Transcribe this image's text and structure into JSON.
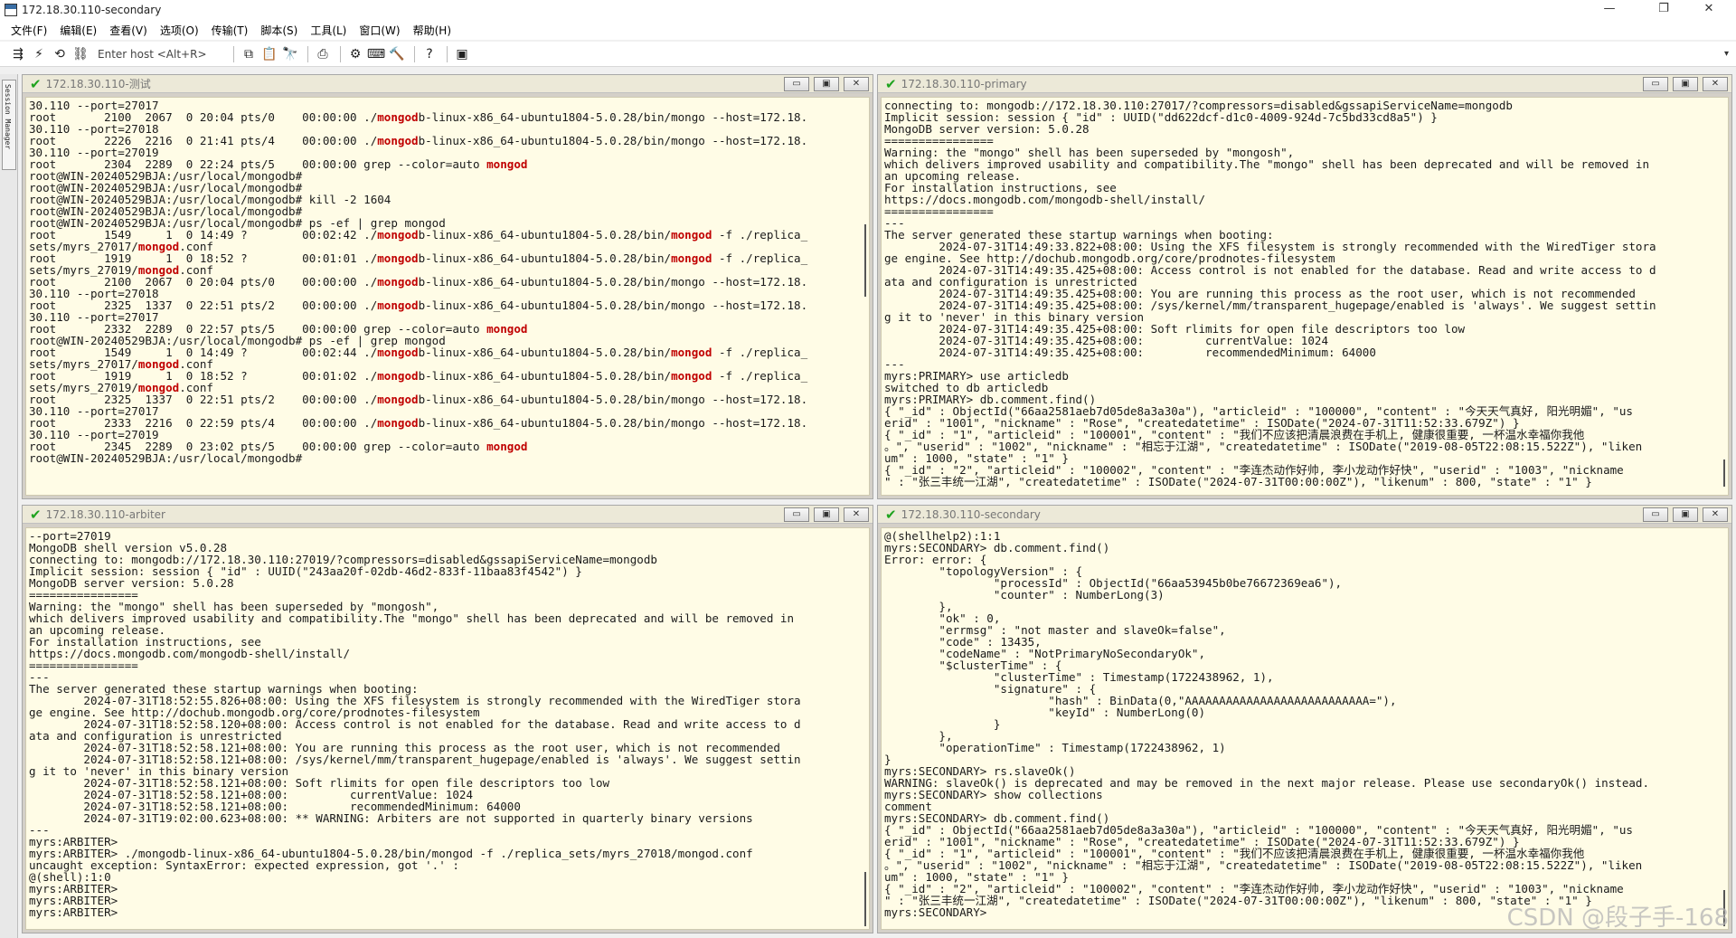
{
  "window": {
    "title": "172.18.30.110-secondary",
    "controls": [
      "—",
      "❐",
      "✕"
    ]
  },
  "menu": [
    "文件(F)",
    "编辑(E)",
    "查看(V)",
    "选项(O)",
    "传输(T)",
    "脚本(S)",
    "工具(L)",
    "窗口(W)",
    "帮助(H)"
  ],
  "toolbar": {
    "left_icons": [
      {
        "icon": "connect-icon",
        "glyph": "⇶"
      },
      {
        "icon": "quick-connect-icon",
        "glyph": "⚡"
      },
      {
        "icon": "reconnect-icon",
        "glyph": "⟲"
      },
      {
        "icon": "link-icon",
        "glyph": "⛓"
      }
    ],
    "host_placeholder": "Enter host <Alt+R>",
    "right_icons": [
      {
        "icon": "copy-icon",
        "glyph": "⧉"
      },
      {
        "icon": "paste-icon",
        "glyph": "📋"
      },
      {
        "icon": "find-icon",
        "glyph": "🔭"
      },
      {
        "icon": "print-icon",
        "glyph": "⎙"
      },
      {
        "icon": "settings-icon",
        "glyph": "⚙"
      },
      {
        "icon": "keymap-icon",
        "glyph": "⌨"
      },
      {
        "icon": "tools-icon",
        "glyph": "🔨"
      },
      {
        "icon": "help-icon",
        "glyph": "?"
      },
      {
        "icon": "screen-icon",
        "glyph": "▣"
      }
    ]
  },
  "sidebar": {
    "label": "Session Manager"
  },
  "panes": [
    {
      "title": "172.18.30.110-测试",
      "lines": [
        "30.110 --port=27017",
        "root       2100  2067  0 20:04 pts/0    00:00:00 ./[mongod]b-linux-x86_64-ubuntu1804-5.0.28/bin/mongo --host=172.18.",
        "30.110 --port=27018",
        "root       2226  2216  0 21:41 pts/4    00:00:00 ./[mongod]b-linux-x86_64-ubuntu1804-5.0.28/bin/mongo --host=172.18.",
        "30.110 --port=27019",
        "root       2304  2289  0 22:24 pts/5    00:00:00 grep --color=auto [mongod]",
        "root@WIN-20240529BJA:/usr/local/mongodb#",
        "root@WIN-20240529BJA:/usr/local/mongodb#",
        "root@WIN-20240529BJA:/usr/local/mongodb# kill -2 1604",
        "root@WIN-20240529BJA:/usr/local/mongodb#",
        "root@WIN-20240529BJA:/usr/local/mongodb# ps -ef | grep mongod",
        "root       1549     1  0 14:49 ?        00:02:42 ./[mongod]b-linux-x86_64-ubuntu1804-5.0.28/bin/[mongod] -f ./replica_",
        "sets/myrs_27017/[mongod].conf",
        "root       1919     1  0 18:52 ?        00:01:01 ./[mongod]b-linux-x86_64-ubuntu1804-5.0.28/bin/[mongod] -f ./replica_",
        "sets/myrs_27019/[mongod].conf",
        "root       2100  2067  0 20:04 pts/0    00:00:00 ./[mongod]b-linux-x86_64-ubuntu1804-5.0.28/bin/mongo --host=172.18.",
        "30.110 --port=27018",
        "root       2325  1337  0 22:51 pts/2    00:00:00 ./[mongod]b-linux-x86_64-ubuntu1804-5.0.28/bin/mongo --host=172.18.",
        "30.110 --port=27017",
        "root       2332  2289  0 22:57 pts/5    00:00:00 grep --color=auto [mongod]",
        "root@WIN-20240529BJA:/usr/local/mongodb# ps -ef | grep mongod",
        "root       1549     1  0 14:49 ?        00:02:44 ./[mongod]b-linux-x86_64-ubuntu1804-5.0.28/bin/[mongod] -f ./replica_",
        "sets/myrs_27017/[mongod].conf",
        "root       1919     1  0 18:52 ?        00:01:02 ./[mongod]b-linux-x86_64-ubuntu1804-5.0.28/bin/[mongod] -f ./replica_",
        "sets/myrs_27019/[mongod].conf",
        "root       2325  1337  0 22:51 pts/2    00:00:00 ./[mongod]b-linux-x86_64-ubuntu1804-5.0.28/bin/mongo --host=172.18.",
        "30.110 --port=27017",
        "root       2333  2216  0 22:59 pts/4    00:00:00 ./[mongod]b-linux-x86_64-ubuntu1804-5.0.28/bin/mongo --host=172.18.",
        "30.110 --port=27019",
        "root       2345  2289  0 23:02 pts/5    00:00:00 grep --color=auto [mongod]",
        "root@WIN-20240529BJA:/usr/local/mongodb#"
      ]
    },
    {
      "title": "172.18.30.110-primary",
      "lines": [
        "connecting to: mongodb://172.18.30.110:27017/?compressors=disabled&gssapiServiceName=mongodb",
        "Implicit session: session { \"id\" : UUID(\"dd622dcf-d1c0-4009-924d-7c5bd33cd8a5\") }",
        "MongoDB server version: 5.0.28",
        "================",
        "Warning: the \"mongo\" shell has been superseded by \"mongosh\",",
        "which delivers improved usability and compatibility.The \"mongo\" shell has been deprecated and will be removed in",
        "an upcoming release.",
        "For installation instructions, see",
        "https://docs.mongodb.com/mongodb-shell/install/",
        "================",
        "---",
        "The server generated these startup warnings when booting:",
        "        2024-07-31T14:49:33.822+08:00: Using the XFS filesystem is strongly recommended with the WiredTiger stora",
        "ge engine. See http://dochub.mongodb.org/core/prodnotes-filesystem",
        "        2024-07-31T14:49:35.425+08:00: Access control is not enabled for the database. Read and write access to d",
        "ata and configuration is unrestricted",
        "        2024-07-31T14:49:35.425+08:00: You are running this process as the root user, which is not recommended",
        "        2024-07-31T14:49:35.425+08:00: /sys/kernel/mm/transparent_hugepage/enabled is 'always'. We suggest settin",
        "g it to 'never' in this binary version",
        "        2024-07-31T14:49:35.425+08:00: Soft rlimits for open file descriptors too low",
        "        2024-07-31T14:49:35.425+08:00:         currentValue: 1024",
        "        2024-07-31T14:49:35.425+08:00:         recommendedMinimum: 64000",
        "---",
        "myrs:PRIMARY> use articledb",
        "switched to db articledb",
        "myrs:PRIMARY> db.comment.find()",
        "{ \"_id\" : ObjectId(\"66aa2581aeb7d05de8a3a30a\"), \"articleid\" : \"100000\", \"content\" : \"今天天气真好, 阳光明媚\", \"us",
        "erid\" : \"1001\", \"nickname\" : \"Rose\", \"createdatetime\" : ISODate(\"2024-07-31T11:52:33.679Z\") }",
        "{ \"_id\" : \"1\", \"articleid\" : \"100001\", \"content\" : \"我们不应该把清晨浪费在手机上, 健康很重要, 一杯温水幸福你我他",
        "。\", \"userid\" : \"1002\", \"nickname\" : \"相忘于江湖\", \"createdatetime\" : ISODate(\"2019-08-05T22:08:15.522Z\"), \"liken",
        "um\" : 1000, \"state\" : \"1\" }",
        "{ \"_id\" : \"2\", \"articleid\" : \"100002\", \"content\" : \"李连杰动作好帅, 李小龙动作好快\", \"userid\" : \"1003\", \"nickname",
        "\" : \"张三丰统一江湖\", \"createdatetime\" : ISODate(\"2024-07-31T00:00:00Z\"), \"likenum\" : 800, \"state\" : \"1\" }"
      ]
    },
    {
      "title": "172.18.30.110-arbiter",
      "lines": [
        "--port=27019",
        "MongoDB shell version v5.0.28",
        "connecting to: mongodb://172.18.30.110:27019/?compressors=disabled&gssapiServiceName=mongodb",
        "Implicit session: session { \"id\" : UUID(\"243aa20f-02db-46d2-833f-11baa83f4542\") }",
        "MongoDB server version: 5.0.28",
        "================",
        "Warning: the \"mongo\" shell has been superseded by \"mongosh\",",
        "which delivers improved usability and compatibility.The \"mongo\" shell has been deprecated and will be removed in",
        "an upcoming release.",
        "For installation instructions, see",
        "https://docs.mongodb.com/mongodb-shell/install/",
        "================",
        "---",
        "The server generated these startup warnings when booting:",
        "        2024-07-31T18:52:55.826+08:00: Using the XFS filesystem is strongly recommended with the WiredTiger stora",
        "ge engine. See http://dochub.mongodb.org/core/prodnotes-filesystem",
        "        2024-07-31T18:52:58.120+08:00: Access control is not enabled for the database. Read and write access to d",
        "ata and configuration is unrestricted",
        "        2024-07-31T18:52:58.121+08:00: You are running this process as the root user, which is not recommended",
        "        2024-07-31T18:52:58.121+08:00: /sys/kernel/mm/transparent_hugepage/enabled is 'always'. We suggest settin",
        "g it to 'never' in this binary version",
        "        2024-07-31T18:52:58.121+08:00: Soft rlimits for open file descriptors too low",
        "        2024-07-31T18:52:58.121+08:00:         currentValue: 1024",
        "        2024-07-31T18:52:58.121+08:00:         recommendedMinimum: 64000",
        "        2024-07-31T19:02:00.623+08:00: ** WARNING: Arbiters are not supported in quarterly binary versions",
        "---",
        "myrs:ARBITER>",
        "myrs:ARBITER> ./mongodb-linux-x86_64-ubuntu1804-5.0.28/bin/mongod -f ./replica_sets/myrs_27018/mongod.conf",
        "uncaught exception: SyntaxError: expected expression, got '.' :",
        "@(shell):1:0",
        "myrs:ARBITER>",
        "myrs:ARBITER>",
        "myrs:ARBITER>"
      ]
    },
    {
      "title": "172.18.30.110-secondary",
      "lines": [
        "@(shellhelp2):1:1",
        "myrs:SECONDARY> db.comment.find()",
        "Error: error: {",
        "        \"topologyVersion\" : {",
        "                \"processId\" : ObjectId(\"66aa53945b0be76672369ea6\"),",
        "                \"counter\" : NumberLong(3)",
        "        },",
        "        \"ok\" : 0,",
        "        \"errmsg\" : \"not master and slaveOk=false\",",
        "        \"code\" : 13435,",
        "        \"codeName\" : \"NotPrimaryNoSecondaryOk\",",
        "        \"$clusterTime\" : {",
        "                \"clusterTime\" : Timestamp(1722438962, 1),",
        "                \"signature\" : {",
        "                        \"hash\" : BinData(0,\"AAAAAAAAAAAAAAAAAAAAAAAAAAA=\"),",
        "                        \"keyId\" : NumberLong(0)",
        "                }",
        "        },",
        "        \"operationTime\" : Timestamp(1722438962, 1)",
        "}",
        "myrs:SECONDARY> rs.slaveOk()",
        "WARNING: slaveOk() is deprecated and may be removed in the next major release. Please use secondaryOk() instead.",
        "myrs:SECONDARY> show collections",
        "comment",
        "myrs:SECONDARY> db.comment.find()",
        "{ \"_id\" : ObjectId(\"66aa2581aeb7d05de8a3a30a\"), \"articleid\" : \"100000\", \"content\" : \"今天天气真好, 阳光明媚\", \"us",
        "erid\" : \"1001\", \"nickname\" : \"Rose\", \"createdatetime\" : ISODate(\"2024-07-31T11:52:33.679Z\") }",
        "{ \"_id\" : \"1\", \"articleid\" : \"100001\", \"content\" : \"我们不应该把清晨浪费在手机上, 健康很重要, 一杯温水幸福你我他",
        "。\", \"userid\" : \"1002\", \"nickname\" : \"相忘于江湖\", \"createdatetime\" : ISODate(\"2019-08-05T22:08:15.522Z\"), \"liken",
        "um\" : 1000, \"state\" : \"1\" }",
        "{ \"_id\" : \"2\", \"articleid\" : \"100002\", \"content\" : \"李连杰动作好帅, 李小龙动作好快\", \"userid\" : \"1003\", \"nickname",
        "\" : \"张三丰统一江湖\", \"createdatetime\" : ISODate(\"2024-07-31T00:00:00Z\"), \"likenum\" : 800, \"state\" : \"1\" }",
        "myrs:SECONDARY>"
      ]
    }
  ],
  "pane_buttons": [
    "▭",
    "▣",
    "✕"
  ],
  "watermark": "CSDN @段子手-168"
}
